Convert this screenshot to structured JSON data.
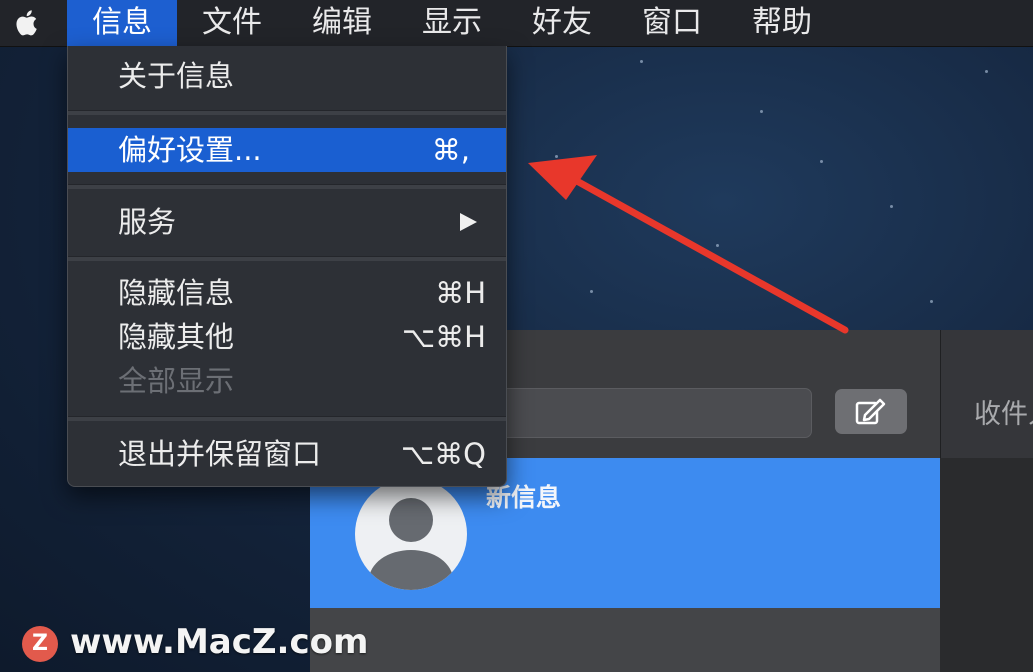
{
  "menubar": {
    "apple_icon": "apple-logo-icon",
    "items": [
      {
        "label": "信息",
        "active": true
      },
      {
        "label": "文件"
      },
      {
        "label": "编辑"
      },
      {
        "label": "显示"
      },
      {
        "label": "好友"
      },
      {
        "label": "窗口"
      },
      {
        "label": "帮助"
      }
    ]
  },
  "menu": {
    "about": {
      "label": "关于信息"
    },
    "preferences": {
      "label": "偏好设置...",
      "shortcut": "⌘,"
    },
    "services": {
      "label": "服务",
      "submenu_icon": "triangle-right-icon"
    },
    "hide": {
      "label": "隐藏信息",
      "shortcut": "⌘H"
    },
    "hide_others": {
      "label": "隐藏其他",
      "shortcut": "⌥⌘H"
    },
    "show_all": {
      "label": "全部显示",
      "disabled": true
    },
    "quit_keep": {
      "label": "退出并保留窗口",
      "shortcut": "⌥⌘Q"
    }
  },
  "messages": {
    "search_placeholder": "",
    "compose_icon": "compose-icon",
    "conversation": {
      "name": "新信息"
    },
    "to_label": "收件人"
  },
  "watermark": {
    "logo_letter": "Z",
    "text": "www.MacZ.com"
  },
  "colors": {
    "highlight": "#1a5fd1",
    "conversation_selected": "#3d8bf0",
    "arrow": "#e8372b"
  }
}
